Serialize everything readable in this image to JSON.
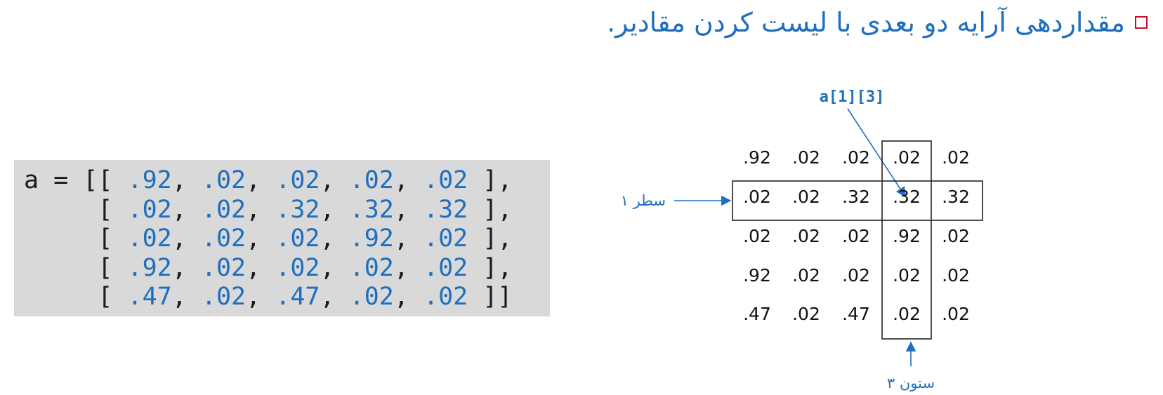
{
  "title": "مقداردهی آرایه دو بعدی با لیست کردن مقادیر.",
  "code": {
    "prefix": "a = ",
    "rows": [
      [
        ".92",
        ".02",
        ".02",
        ".02",
        ".02"
      ],
      [
        ".02",
        ".02",
        ".32",
        ".32",
        ".32"
      ],
      [
        ".02",
        ".02",
        ".02",
        ".92",
        ".02"
      ],
      [
        ".92",
        ".02",
        ".02",
        ".02",
        ".02"
      ],
      [
        ".47",
        ".02",
        ".47",
        ".02",
        ".02"
      ]
    ]
  },
  "diagram": {
    "element_label": "a[1][3]",
    "row_label": "سطر ۱",
    "col_label": "ستون ۳",
    "highlight_row": 1,
    "highlight_col": 3
  },
  "colors": {
    "accent": "#1f6fbf",
    "bullet": "#c8102e",
    "code_bg": "#d9d9d9"
  }
}
